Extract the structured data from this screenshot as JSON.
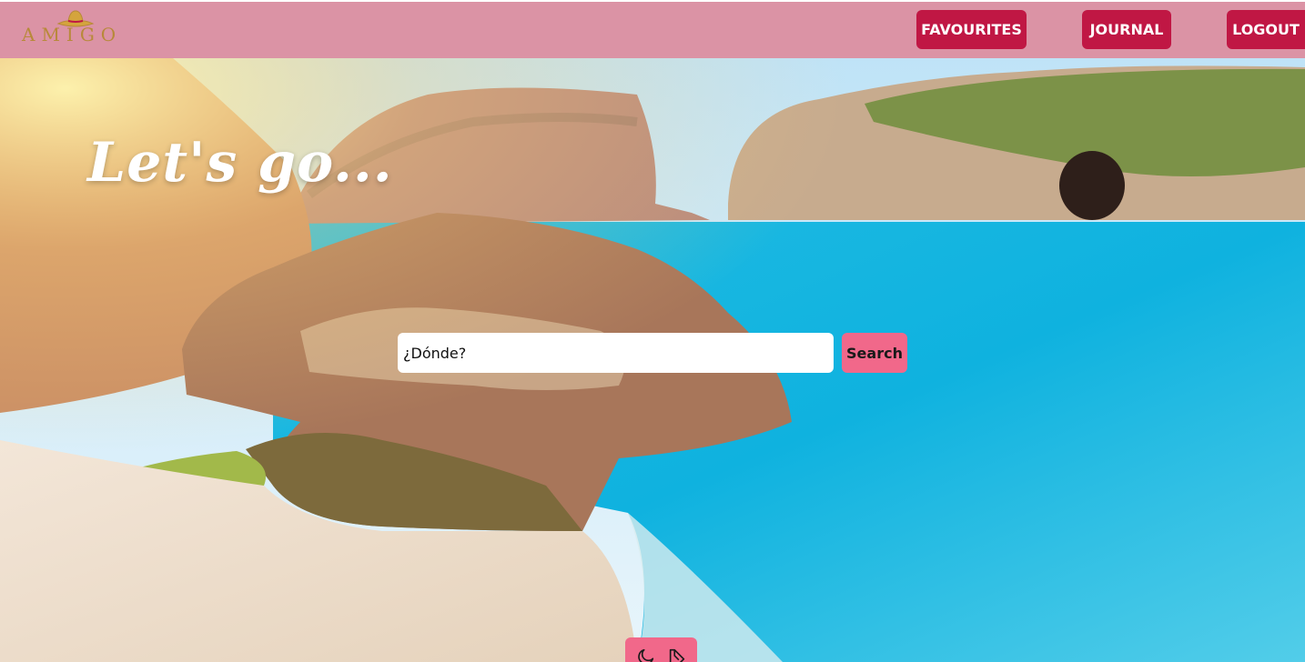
{
  "brand": {
    "logo_text": "AMIGO",
    "logo_icon": "sombrero-icon",
    "color": "#b8893a"
  },
  "nav": {
    "favourites_label": "FAVOURITES",
    "journal_label": "JOURNAL",
    "logout_label": "LOGOUT",
    "bar_color": "#db93a5",
    "button_color": "#c01744"
  },
  "hero": {
    "headline": "Let's go..."
  },
  "search": {
    "placeholder": "¿Dónde?",
    "value": "",
    "button_label": "Search",
    "button_color": "#f1688a"
  },
  "theme_toggle": {
    "icons": [
      "moon-icon",
      "edit-icon"
    ]
  }
}
